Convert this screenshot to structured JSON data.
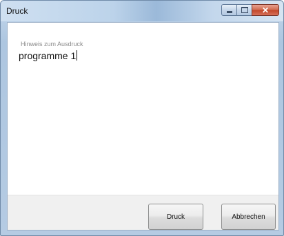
{
  "window": {
    "title": "Druck",
    "close_glyph": "✕"
  },
  "form": {
    "hint_label": "Hinweis zum Ausdruck",
    "hint_value": "programme 1"
  },
  "buttons": {
    "print_label": "Druck",
    "cancel_label": "Abbrechen"
  },
  "icons": [
    "minimize-icon",
    "maximize-icon",
    "close-icon"
  ]
}
